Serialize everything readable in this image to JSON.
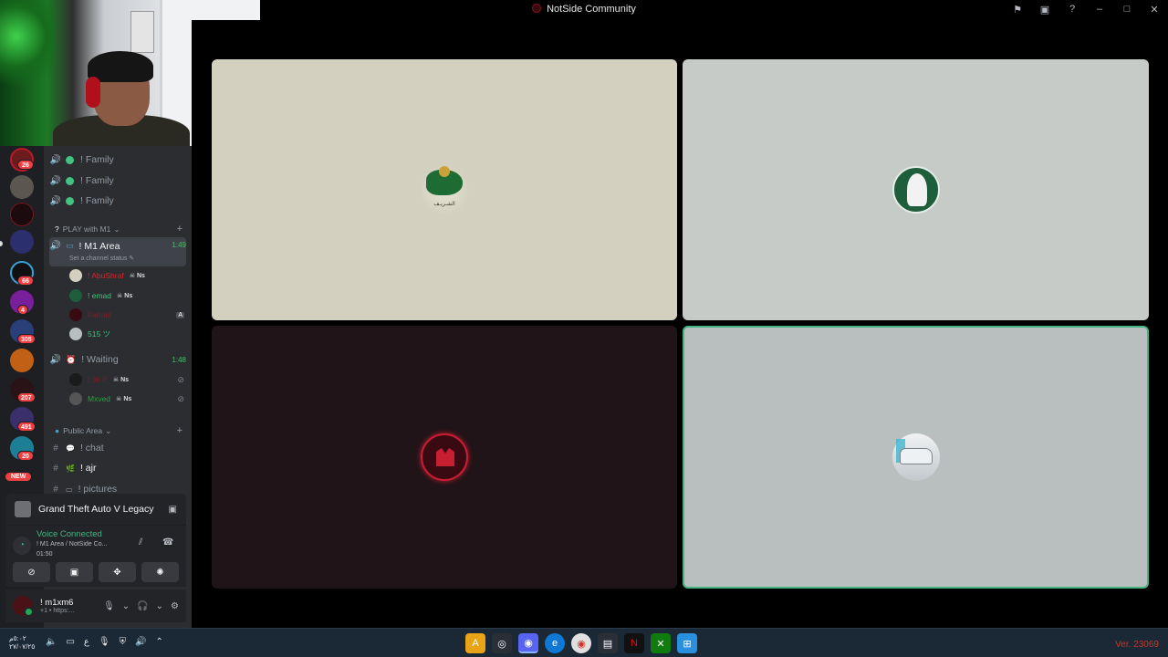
{
  "window": {
    "title": "NotSide Community"
  },
  "rail": {
    "badges": [
      "26",
      "66",
      "4",
      "305",
      "207",
      "491",
      "20"
    ],
    "new_label": "NEW"
  },
  "sidebar": {
    "family_channels": [
      {
        "label": "! Family"
      },
      {
        "label": "! Family"
      },
      {
        "label": "! Family"
      }
    ],
    "category_play": "PLAY with M1",
    "m1_area": {
      "label": "! M1 Area",
      "time": "1:49",
      "status": "Set a channel status"
    },
    "m1_users": [
      {
        "name": "! AbuShraf",
        "tag": "Ns",
        "color": "#d2282c"
      },
      {
        "name": "! emad",
        "tag": "Ns",
        "color": "#43c37f"
      },
      {
        "name": "Fahaid",
        "tag": "",
        "color": "#c0392b"
      },
      {
        "name": "515 ツ",
        "tag": "",
        "color": "#43c37f"
      }
    ],
    "waiting": {
      "label": "! Waiting",
      "time": "1:48"
    },
    "waiting_users": [
      {
        "name": "! 3li ¹⁰",
        "tag": "Ns",
        "color": "#c0392b"
      },
      {
        "name": "Mxved",
        "tag": "Ns",
        "color": "#2f9e44"
      }
    ],
    "category_public": "Public Area",
    "text_channels": [
      {
        "label": "! chat"
      },
      {
        "label": "! ajr"
      },
      {
        "label": "! pictures"
      }
    ]
  },
  "activity": {
    "game": "Grand Theft Auto V Legacy"
  },
  "voice": {
    "status": "Voice Connected",
    "location": "! M1 Area / NotSide Co...",
    "timer": "01:50"
  },
  "user": {
    "name": "! m1xm6",
    "sub": "+1 • https:..."
  },
  "tiles": [
    {
      "caption": "الشـريـف"
    },
    {
      "caption": ""
    },
    {
      "caption": ""
    },
    {
      "caption": ""
    }
  ],
  "taskbar": {
    "time": "٥:٠٢م",
    "date": "٢٧/٠٧/٢٥",
    "lang": "ع",
    "version": "Ver. 23069"
  },
  "icons": [
    "flag-icon",
    "screen-icon",
    "help-icon",
    "minimize-icon",
    "maximize-icon",
    "close-icon"
  ],
  "colors": {
    "accent_green": "#43b581",
    "sidebar_bg": "#2b2d31",
    "rail_bg": "#1e1f22",
    "badge_red": "#f23f42"
  }
}
